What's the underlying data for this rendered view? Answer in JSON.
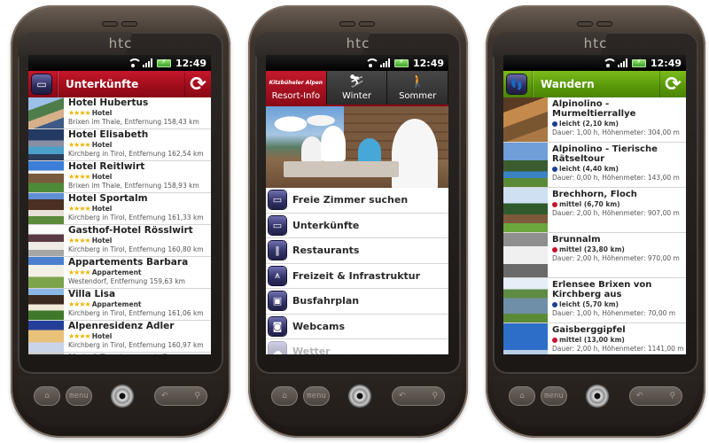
{
  "status_bar": {
    "time": "12:49"
  },
  "device": {
    "brand": "htc",
    "buttons": {
      "home": "home-icon",
      "menu": "menu",
      "back": "back-icon",
      "search": "search-icon"
    }
  },
  "phone1": {
    "header": {
      "title": "Unterkünfte",
      "icon": "bed-icon",
      "refresh_icon": "refresh-icon",
      "color": "#a10d1c"
    },
    "hotels": [
      {
        "name": "Hotel Hubertus",
        "stars": 4,
        "category": "Hotel",
        "distance": "Brixen im Thale, Entfernung 158,43 km"
      },
      {
        "name": "Hotel Elisabeth",
        "stars": 4,
        "category": "Hotel",
        "distance": "Kirchberg in Tirol, Entfernung 162,54 km"
      },
      {
        "name": "Hotel Reitlwirt",
        "stars": 4,
        "category": "Hotel",
        "distance": "Brixen im Thale, Entfernung 158,93 km"
      },
      {
        "name": "Hotel Sportalm",
        "stars": 4,
        "category": "Hotel",
        "distance": "Kirchberg in Tirol, Entfernung 161,33 km"
      },
      {
        "name": "Gasthof-Hotel Rösslwirt",
        "stars": 4,
        "category": "Hotel",
        "distance": "Kirchberg in Tirol, Entfernung 160,80 km"
      },
      {
        "name": "Appartements Barbara",
        "stars": 4,
        "category": "Appartement",
        "distance": "Westendorf, Entfernung 159,63 km"
      },
      {
        "name": "Villa Lisa",
        "stars": 4,
        "category": "Appartement",
        "distance": "Kirchberg in Tirol, Entfernung 161,06 km"
      },
      {
        "name": "Alpenresidenz Adler",
        "stars": 4,
        "category": "Hotel",
        "distance": "Kirchberg in Tirol, Entfernung 160,97 km"
      },
      {
        "name": "Hotel Restaurant Spa",
        "stars": 0,
        "category": "",
        "distance": ""
      }
    ]
  },
  "phone2": {
    "tabs": [
      {
        "label": "Resort-Info",
        "brand": "Kitzbüheler Alpen",
        "active": true
      },
      {
        "label": "Winter",
        "icon": "ski-boot-icon",
        "active": false
      },
      {
        "label": "Sommer",
        "icon": "hikers-icon",
        "active": false
      }
    ],
    "hero_alt": "Family eating at a mountain hut",
    "menu": [
      {
        "label": "Freie Zimmer suchen",
        "icon": "bed-icon",
        "glyph": "▭"
      },
      {
        "label": "Unterkünfte",
        "icon": "bed-icon",
        "glyph": "▭"
      },
      {
        "label": "Restaurants",
        "icon": "cutlery-icon",
        "glyph": "‖"
      },
      {
        "label": "Freizeit & Infrastruktur",
        "icon": "cable-car-icon",
        "glyph": "⩚"
      },
      {
        "label": "Busfahrplan",
        "icon": "bus-icon",
        "glyph": "▣"
      },
      {
        "label": "Webcams",
        "icon": "camera-icon",
        "glyph": "◙"
      },
      {
        "label": "Wetter",
        "icon": "weather-icon",
        "glyph": "☁"
      }
    ]
  },
  "phone3": {
    "header": {
      "title": "Wandern",
      "icon": "hikers-icon",
      "refresh_icon": "refresh-icon",
      "color": "#5a9a0a"
    },
    "hikes": [
      {
        "name": "Alpinolino - Murmeltierrallye",
        "level": "leicht (2,10 km)",
        "difficulty": "easy",
        "meta": "Dauer: 1,00 h, Höhenmeter: 304,00 m"
      },
      {
        "name": "Alpinolino - Tierische Rätseltour",
        "level": "leicht (4,40 km)",
        "difficulty": "easy",
        "meta": "Dauer: 0,00 h, Höhenmeter: 143,00 m"
      },
      {
        "name": "Brechhorn, Floch",
        "level": "mittel (6,70 km)",
        "difficulty": "medium",
        "meta": "Dauer: 2,00 h, Höhenmeter: 907,00 m"
      },
      {
        "name": "Brunnalm",
        "level": "mittel (23,80 km)",
        "difficulty": "medium",
        "meta": "Dauer: 2,00 h, Höhenmeter: 970,00 m"
      },
      {
        "name": "Erlensee Brixen von Kirchberg aus",
        "level": "leicht (5,70 km)",
        "difficulty": "easy",
        "meta": "Dauer: 1,00 h, Höhenmeter: 70,00 m"
      },
      {
        "name": "Gaisberggipfel",
        "level": "mittel (13,00 km)",
        "difficulty": "medium",
        "meta": "Dauer: 2,00 h, Höhenmeter: 1141,00 m"
      }
    ],
    "difficulty_colors": {
      "easy": "#1c3f94",
      "medium": "#c8102e"
    }
  }
}
